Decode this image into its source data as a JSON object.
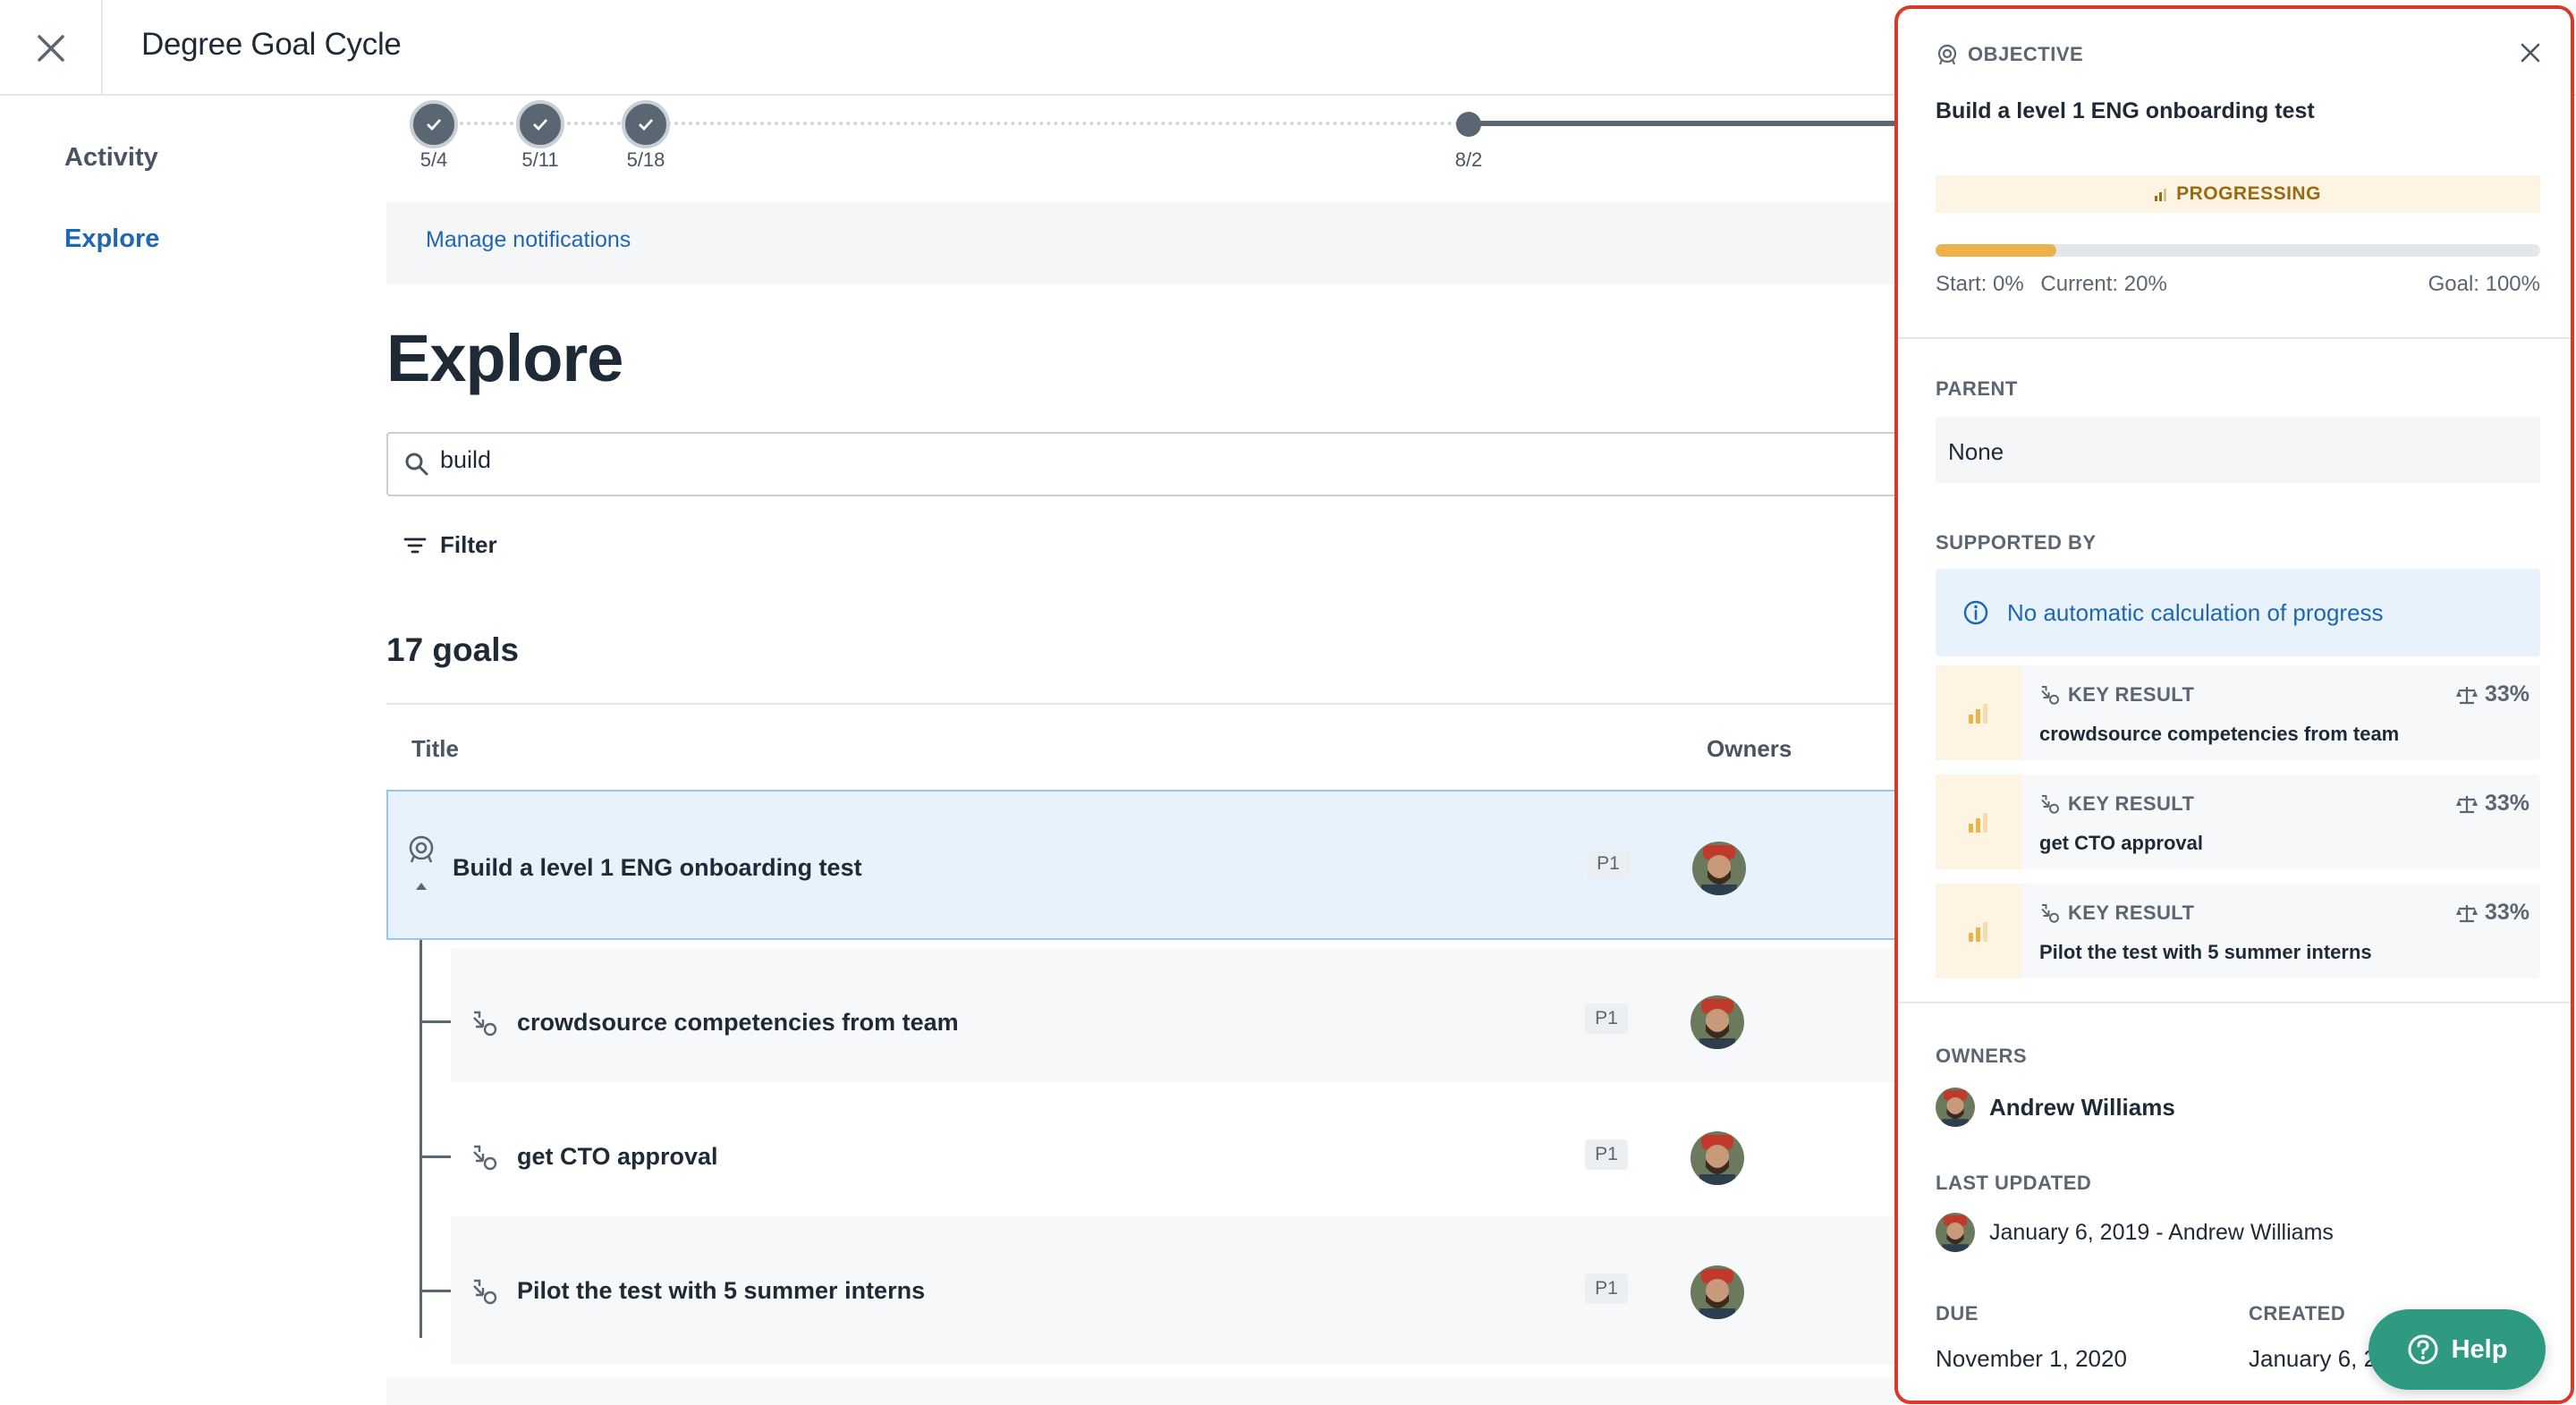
{
  "header": {
    "title": "Degree Goal Cycle",
    "close_icon": "close-icon"
  },
  "nav": {
    "items": [
      {
        "label": "Activity"
      },
      {
        "label": "Explore",
        "active": true
      }
    ]
  },
  "timeline": {
    "labels": [
      "5/4",
      "5/11",
      "5/18",
      "8/2"
    ]
  },
  "notifications": {
    "link": "Manage notifications"
  },
  "explore": {
    "title": "Explore",
    "search": {
      "value": "build"
    },
    "filter_label": "Filter",
    "count": "17 goals",
    "columns": {
      "title": "Title",
      "owners": "Owners"
    },
    "rows": [
      {
        "title": "Build a level 1 ENG onboarding test",
        "priority": "P1",
        "type": "objective"
      },
      {
        "title": "crowdsource competencies from team",
        "priority": "P1",
        "type": "key-result"
      },
      {
        "title": "get CTO approval",
        "priority": "P1",
        "type": "key-result"
      },
      {
        "title": "Pilot the test with 5 summer interns",
        "priority": "P1",
        "type": "key-result"
      }
    ]
  },
  "panel": {
    "type_label": "OBJECTIVE",
    "title": "Build a level 1 ENG onboarding test",
    "status": "PROGRESSING",
    "progress": 0.2,
    "start": "Start: 0%",
    "current": "Current: 20%",
    "goal": "Goal: 100%",
    "parent_label": "PARENT",
    "parent_value": "None",
    "supported_by_label": "SUPPORTED BY",
    "info_text": "No automatic calculation of progress",
    "key_results": [
      {
        "label": "KEY RESULT",
        "weight": "33%",
        "title": "crowdsource competencies from team"
      },
      {
        "label": "KEY RESULT",
        "weight": "33%",
        "title": "get CTO approval"
      },
      {
        "label": "KEY RESULT",
        "weight": "33%",
        "title": "Pilot the test with 5 summer interns"
      }
    ],
    "owners_label": "OWNERS",
    "owner_name": "Andrew Williams",
    "last_updated_label": "LAST UPDATED",
    "last_updated_value": "January 6, 2019 - Andrew Williams",
    "due_label": "DUE",
    "due_value": "November 1, 2020",
    "created_label": "CREATED",
    "created_value": "January 6, 2019"
  },
  "help": {
    "label": "Help"
  },
  "colors": {
    "accent": "#1f66b3",
    "progress": "#edb24a",
    "help": "#2e9a82",
    "panel_border": "#d9382b"
  }
}
